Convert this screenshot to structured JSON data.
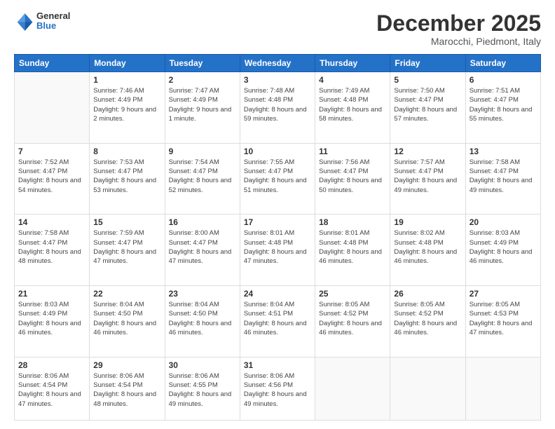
{
  "header": {
    "logo_general": "General",
    "logo_blue": "Blue",
    "month_title": "December 2025",
    "subtitle": "Marocchi, Piedmont, Italy"
  },
  "days_of_week": [
    "Sunday",
    "Monday",
    "Tuesday",
    "Wednesday",
    "Thursday",
    "Friday",
    "Saturday"
  ],
  "weeks": [
    [
      {
        "day": "",
        "info": ""
      },
      {
        "day": "1",
        "info": "Sunrise: 7:46 AM\nSunset: 4:49 PM\nDaylight: 9 hours\nand 2 minutes."
      },
      {
        "day": "2",
        "info": "Sunrise: 7:47 AM\nSunset: 4:49 PM\nDaylight: 9 hours\nand 1 minute."
      },
      {
        "day": "3",
        "info": "Sunrise: 7:48 AM\nSunset: 4:48 PM\nDaylight: 8 hours\nand 59 minutes."
      },
      {
        "day": "4",
        "info": "Sunrise: 7:49 AM\nSunset: 4:48 PM\nDaylight: 8 hours\nand 58 minutes."
      },
      {
        "day": "5",
        "info": "Sunrise: 7:50 AM\nSunset: 4:47 PM\nDaylight: 8 hours\nand 57 minutes."
      },
      {
        "day": "6",
        "info": "Sunrise: 7:51 AM\nSunset: 4:47 PM\nDaylight: 8 hours\nand 55 minutes."
      }
    ],
    [
      {
        "day": "7",
        "info": "Sunrise: 7:52 AM\nSunset: 4:47 PM\nDaylight: 8 hours\nand 54 minutes."
      },
      {
        "day": "8",
        "info": "Sunrise: 7:53 AM\nSunset: 4:47 PM\nDaylight: 8 hours\nand 53 minutes."
      },
      {
        "day": "9",
        "info": "Sunrise: 7:54 AM\nSunset: 4:47 PM\nDaylight: 8 hours\nand 52 minutes."
      },
      {
        "day": "10",
        "info": "Sunrise: 7:55 AM\nSunset: 4:47 PM\nDaylight: 8 hours\nand 51 minutes."
      },
      {
        "day": "11",
        "info": "Sunrise: 7:56 AM\nSunset: 4:47 PM\nDaylight: 8 hours\nand 50 minutes."
      },
      {
        "day": "12",
        "info": "Sunrise: 7:57 AM\nSunset: 4:47 PM\nDaylight: 8 hours\nand 49 minutes."
      },
      {
        "day": "13",
        "info": "Sunrise: 7:58 AM\nSunset: 4:47 PM\nDaylight: 8 hours\nand 49 minutes."
      }
    ],
    [
      {
        "day": "14",
        "info": "Sunrise: 7:58 AM\nSunset: 4:47 PM\nDaylight: 8 hours\nand 48 minutes."
      },
      {
        "day": "15",
        "info": "Sunrise: 7:59 AM\nSunset: 4:47 PM\nDaylight: 8 hours\nand 47 minutes."
      },
      {
        "day": "16",
        "info": "Sunrise: 8:00 AM\nSunset: 4:47 PM\nDaylight: 8 hours\nand 47 minutes."
      },
      {
        "day": "17",
        "info": "Sunrise: 8:01 AM\nSunset: 4:48 PM\nDaylight: 8 hours\nand 47 minutes."
      },
      {
        "day": "18",
        "info": "Sunrise: 8:01 AM\nSunset: 4:48 PM\nDaylight: 8 hours\nand 46 minutes."
      },
      {
        "day": "19",
        "info": "Sunrise: 8:02 AM\nSunset: 4:48 PM\nDaylight: 8 hours\nand 46 minutes."
      },
      {
        "day": "20",
        "info": "Sunrise: 8:03 AM\nSunset: 4:49 PM\nDaylight: 8 hours\nand 46 minutes."
      }
    ],
    [
      {
        "day": "21",
        "info": "Sunrise: 8:03 AM\nSunset: 4:49 PM\nDaylight: 8 hours\nand 46 minutes."
      },
      {
        "day": "22",
        "info": "Sunrise: 8:04 AM\nSunset: 4:50 PM\nDaylight: 8 hours\nand 46 minutes."
      },
      {
        "day": "23",
        "info": "Sunrise: 8:04 AM\nSunset: 4:50 PM\nDaylight: 8 hours\nand 46 minutes."
      },
      {
        "day": "24",
        "info": "Sunrise: 8:04 AM\nSunset: 4:51 PM\nDaylight: 8 hours\nand 46 minutes."
      },
      {
        "day": "25",
        "info": "Sunrise: 8:05 AM\nSunset: 4:52 PM\nDaylight: 8 hours\nand 46 minutes."
      },
      {
        "day": "26",
        "info": "Sunrise: 8:05 AM\nSunset: 4:52 PM\nDaylight: 8 hours\nand 46 minutes."
      },
      {
        "day": "27",
        "info": "Sunrise: 8:05 AM\nSunset: 4:53 PM\nDaylight: 8 hours\nand 47 minutes."
      }
    ],
    [
      {
        "day": "28",
        "info": "Sunrise: 8:06 AM\nSunset: 4:54 PM\nDaylight: 8 hours\nand 47 minutes."
      },
      {
        "day": "29",
        "info": "Sunrise: 8:06 AM\nSunset: 4:54 PM\nDaylight: 8 hours\nand 48 minutes."
      },
      {
        "day": "30",
        "info": "Sunrise: 8:06 AM\nSunset: 4:55 PM\nDaylight: 8 hours\nand 49 minutes."
      },
      {
        "day": "31",
        "info": "Sunrise: 8:06 AM\nSunset: 4:56 PM\nDaylight: 8 hours\nand 49 minutes."
      },
      {
        "day": "",
        "info": ""
      },
      {
        "day": "",
        "info": ""
      },
      {
        "day": "",
        "info": ""
      }
    ]
  ]
}
